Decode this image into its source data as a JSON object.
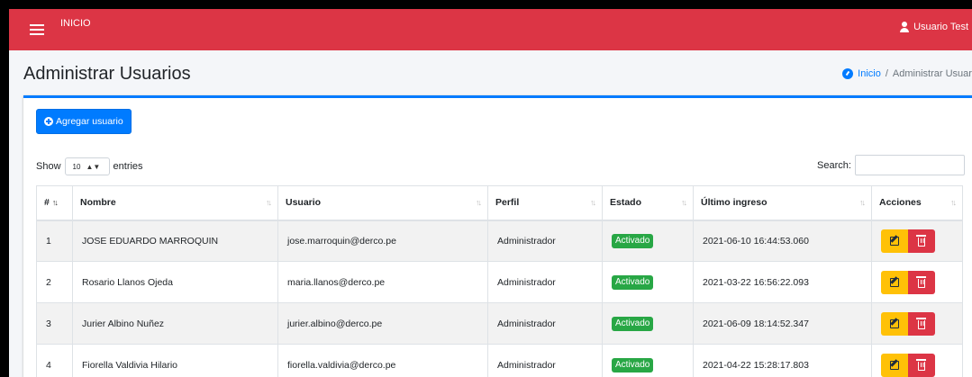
{
  "navbar": {
    "menu_icon": "bars-icon",
    "home_link": "INICIO",
    "user_icon": "user-icon",
    "user_name": "Usuario Test"
  },
  "header": {
    "title": "Administrar Usuarios",
    "breadcrumb": {
      "icon": "dashboard-icon",
      "home": "Inicio",
      "separator": "/",
      "current": "Administrar Usuarios"
    }
  },
  "toolbar": {
    "add_icon": "plus-circle-icon",
    "add_label": "Agregar usuario",
    "show_label": "Show",
    "entries_value": "10",
    "entries_label": "entries",
    "search_label": "Search:",
    "search_value": ""
  },
  "table": {
    "columns": [
      "#",
      "Nombre",
      "Usuario",
      "Perfil",
      "Estado",
      "Último ingreso",
      "Acciones"
    ],
    "rows": [
      {
        "num": "1",
        "nombre": "JOSE EDUARDO MARROQUIN",
        "usuario": "jose.marroquin@derco.pe",
        "perfil": "Administrador",
        "estado": "Activado",
        "ultimo": "2021-06-10 16:44:53.060"
      },
      {
        "num": "2",
        "nombre": "Rosario Llanos Ojeda",
        "usuario": "maria.llanos@derco.pe",
        "perfil": "Administrador",
        "estado": "Activado",
        "ultimo": "2021-03-22 16:56:22.093"
      },
      {
        "num": "3",
        "nombre": "Jurier Albino Nuñez",
        "usuario": "jurier.albino@derco.pe",
        "perfil": "Administrador",
        "estado": "Activado",
        "ultimo": "2021-06-09 18:14:52.347"
      },
      {
        "num": "4",
        "nombre": "Fiorella Valdivia Hilario",
        "usuario": "fiorella.valdivia@derco.pe",
        "perfil": "Administrador",
        "estado": "Activado",
        "ultimo": "2021-04-22 15:28:17.803"
      }
    ]
  },
  "colors": {
    "navbar": "#dc3545",
    "primary": "#007bff",
    "success": "#28a745",
    "warning": "#ffc107",
    "danger": "#dc3545"
  }
}
